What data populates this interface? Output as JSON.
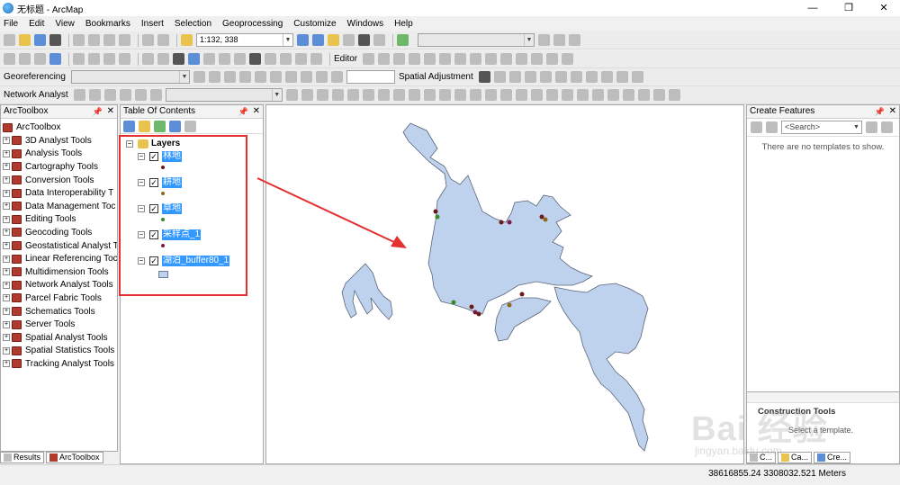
{
  "window": {
    "title": "无标题 - ArcMap",
    "minimize": "—",
    "maximize": "❐",
    "close": "✕"
  },
  "menu": [
    "File",
    "Edit",
    "View",
    "Bookmarks",
    "Insert",
    "Selection",
    "Geoprocessing",
    "Customize",
    "Windows",
    "Help"
  ],
  "toolbar": {
    "scale": "1:132, 338",
    "editor_label": "Editor",
    "georeferencing_label": "Georeferencing",
    "spatial_adjustment_label": "Spatial Adjustment",
    "network_analyst_label": "Network Analyst"
  },
  "toolbox": {
    "title": "ArcToolbox",
    "root": "ArcToolbox",
    "items": [
      "3D Analyst Tools",
      "Analysis Tools",
      "Cartography Tools",
      "Conversion Tools",
      "Data Interoperability T",
      "Data Management Toc",
      "Editing Tools",
      "Geocoding Tools",
      "Geostatistical Analyst T",
      "Linear Referencing Toc",
      "Multidimension Tools",
      "Network Analyst Tools",
      "Parcel Fabric Tools",
      "Schematics Tools",
      "Server Tools",
      "Spatial Analyst Tools",
      "Spatial Statistics Tools",
      "Tracking Analyst Tools"
    ],
    "tabs": {
      "results": "Results",
      "arctoolbox": "ArcToolbox"
    }
  },
  "toc": {
    "title": "Table Of Contents",
    "root_label": "Layers",
    "layers": [
      {
        "name": "林地",
        "symbol_color": "#6b1a1a"
      },
      {
        "name": "耕地",
        "symbol_color": "#8a6a20"
      },
      {
        "name": "草地",
        "symbol_color": "#3a8a2a"
      },
      {
        "name": "采样点_1",
        "symbol_color": "#7a1a4a"
      },
      {
        "name": "湖泊_buffer80_1",
        "symbol_color": "#bed2ee"
      }
    ]
  },
  "create_features": {
    "title": "Create Features",
    "search_placeholder": "<Search>",
    "message": "There are no templates to show.",
    "construction_title": "Construction Tools",
    "construction_note": "Select a template.",
    "tabs": [
      "C...",
      "Ca...",
      "Cre..."
    ]
  },
  "status": {
    "coordinates": "38616855.24  3308032.521 Meters"
  },
  "watermark": {
    "text": "Bai 经验",
    "sub": "jingyan.baidu.com"
  },
  "colors": {
    "lake_fill": "#bed2ee",
    "lake_stroke": "#5a6478",
    "annotation_red": "#e53030",
    "selection_blue": "#3399ff"
  }
}
